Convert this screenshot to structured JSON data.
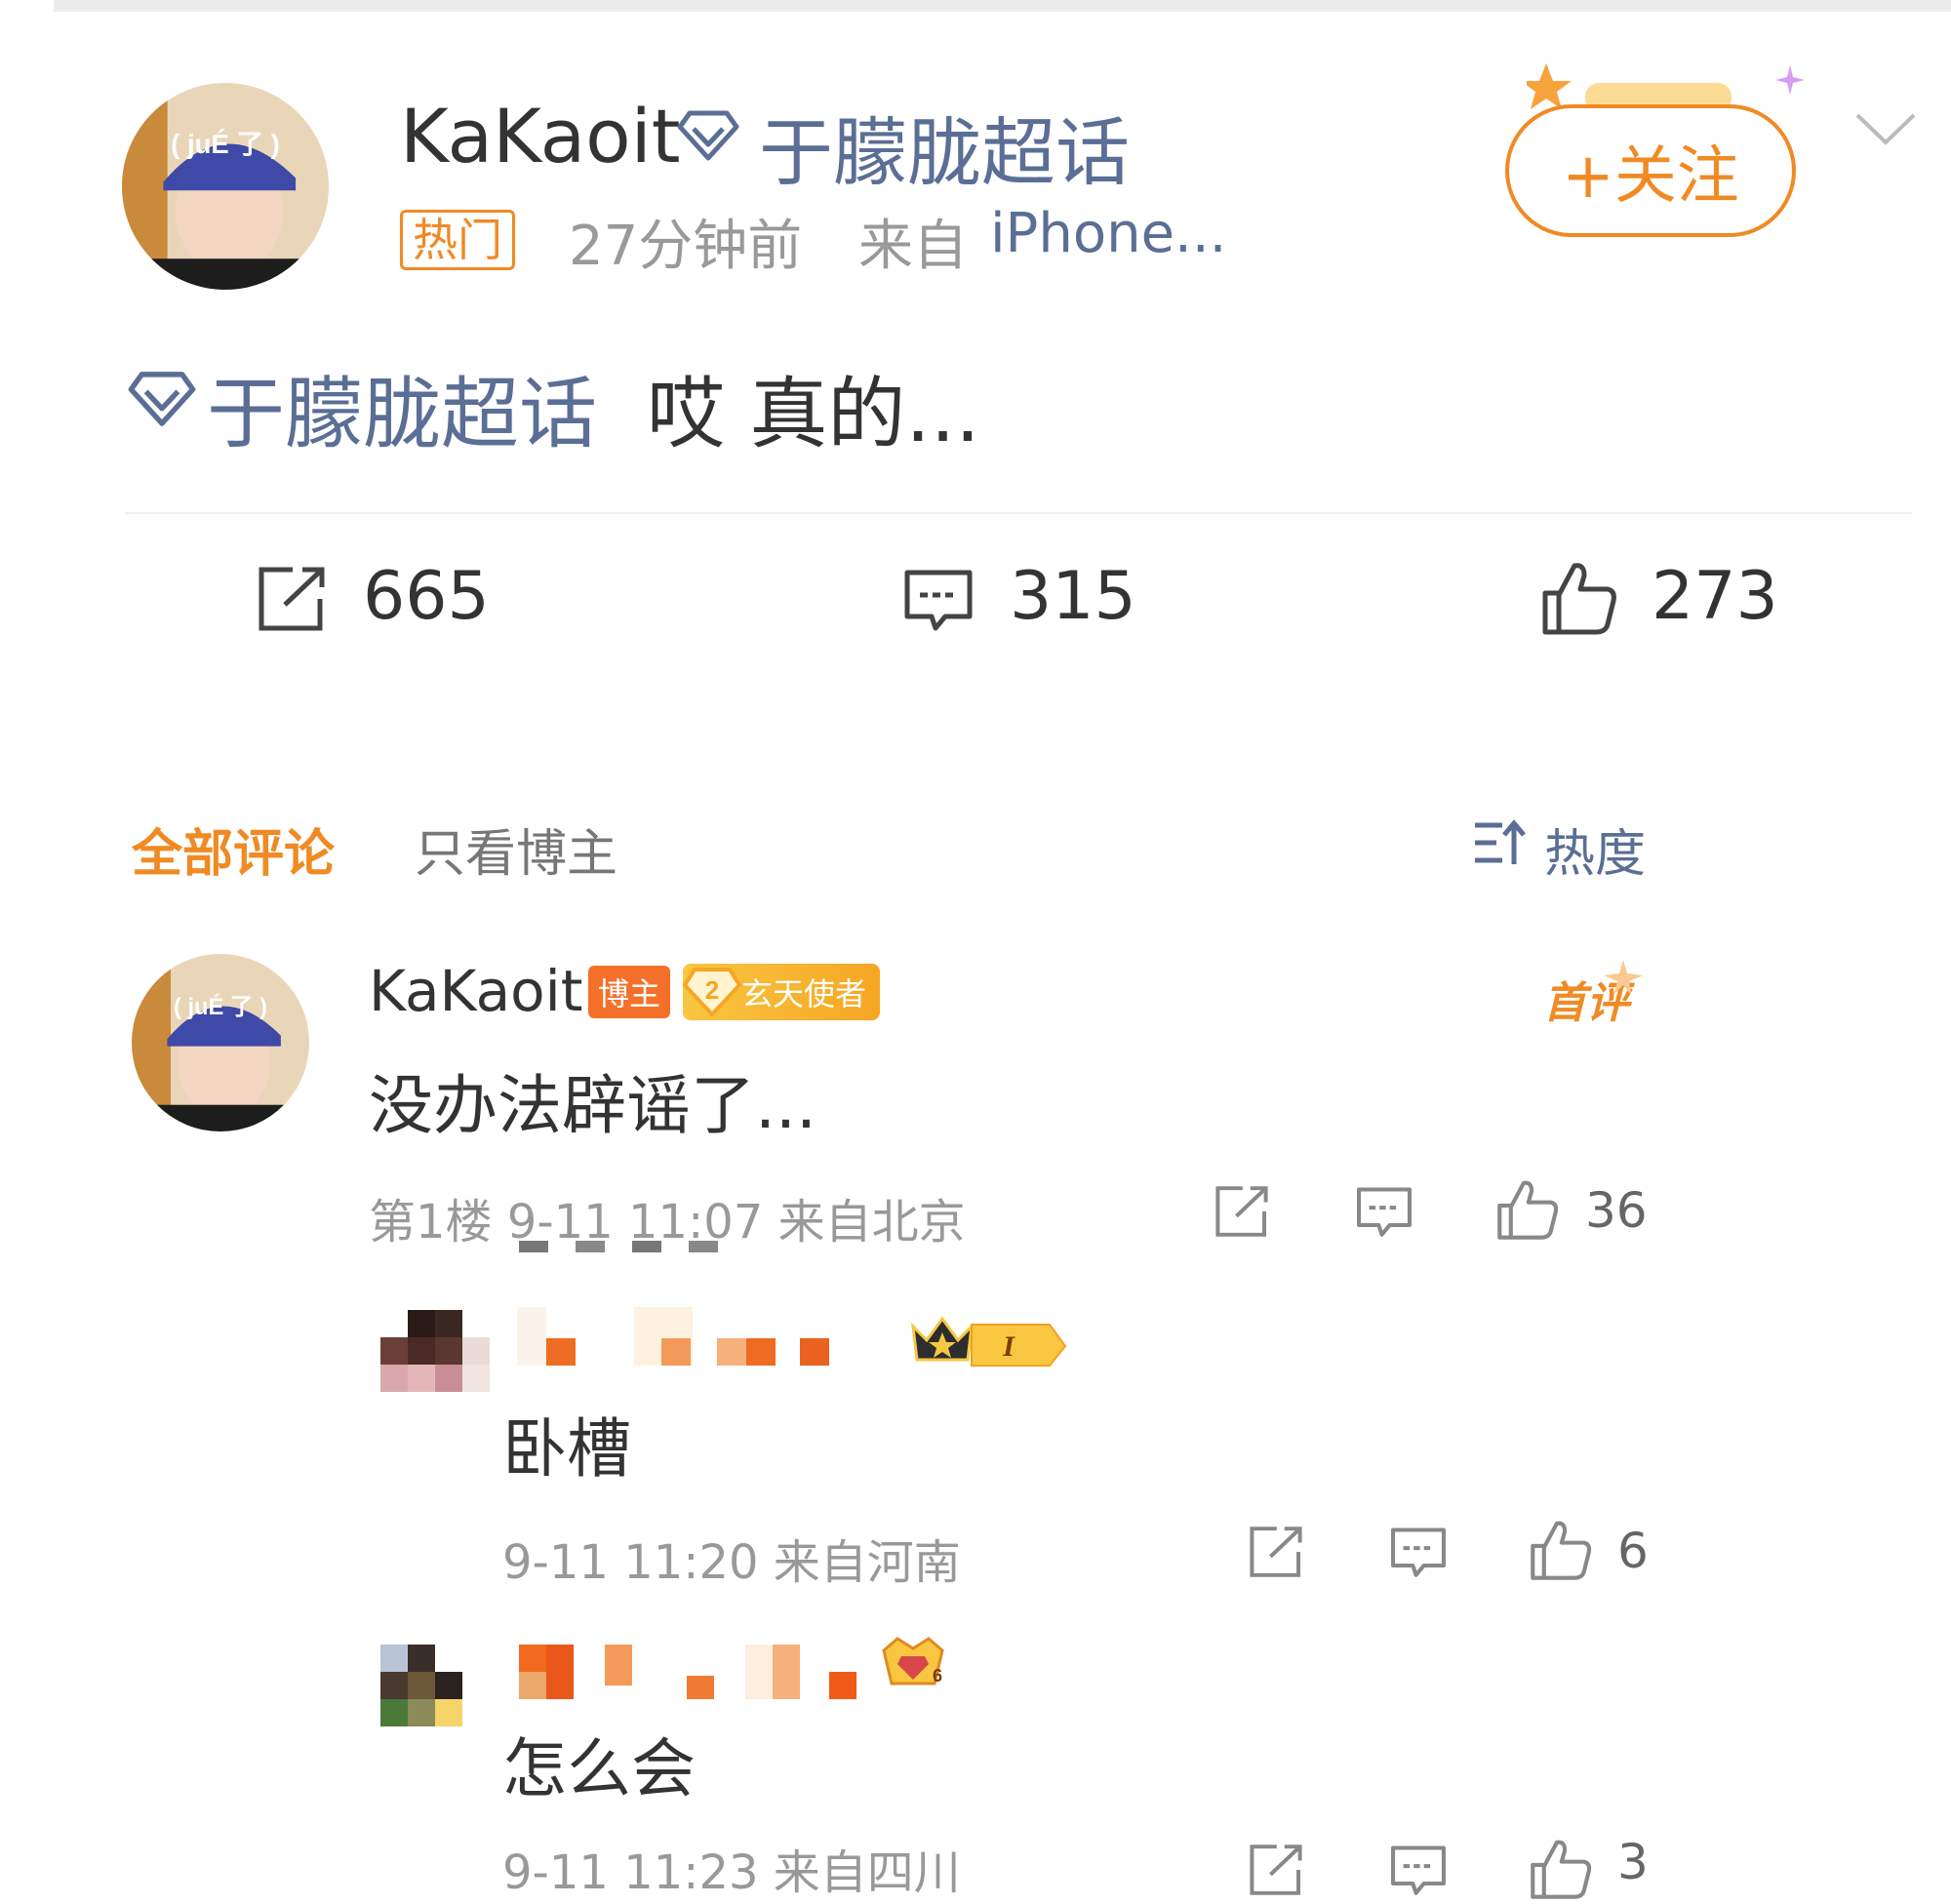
{
  "post": {
    "author": "KaKaoit",
    "topic": "于朦胧超话",
    "hot_tag": "热门",
    "time": "27分钟前",
    "source_prefix": "来自",
    "source_device": "iPhone...",
    "follow_label": "+关注",
    "content_topic": "于朦胧超话",
    "content_text": "哎 真的...",
    "avatar_caption": "( juÉ 了 )"
  },
  "actions": {
    "repost_count": "665",
    "comment_count": "315",
    "like_count": "273"
  },
  "tabs": {
    "all_comments": "全部评论",
    "author_only": "只看博主",
    "sort_label": "热度"
  },
  "comments": [
    {
      "name": "KaKaoit",
      "host_badge": "博主",
      "level_badge": "玄天使者",
      "level_num": "2",
      "first_label": "首评",
      "text": "没办法辟谣了...",
      "meta": "第1楼  9-11 11:07  来自北京",
      "likes": "36",
      "avatar_caption": "( juÉ 了 )"
    },
    {
      "name": "",
      "badge_text": "I",
      "text": "卧槽",
      "meta": "9-11 11:20  来自河南",
      "likes": "6"
    },
    {
      "name": "",
      "badge_text": "6",
      "text": "怎么会",
      "meta": "9-11 11:23  来自四川",
      "likes": "3"
    }
  ],
  "colors": {
    "accent_orange": "#f08a24",
    "link_blue": "#5b6e95",
    "grey_text": "#999999"
  }
}
